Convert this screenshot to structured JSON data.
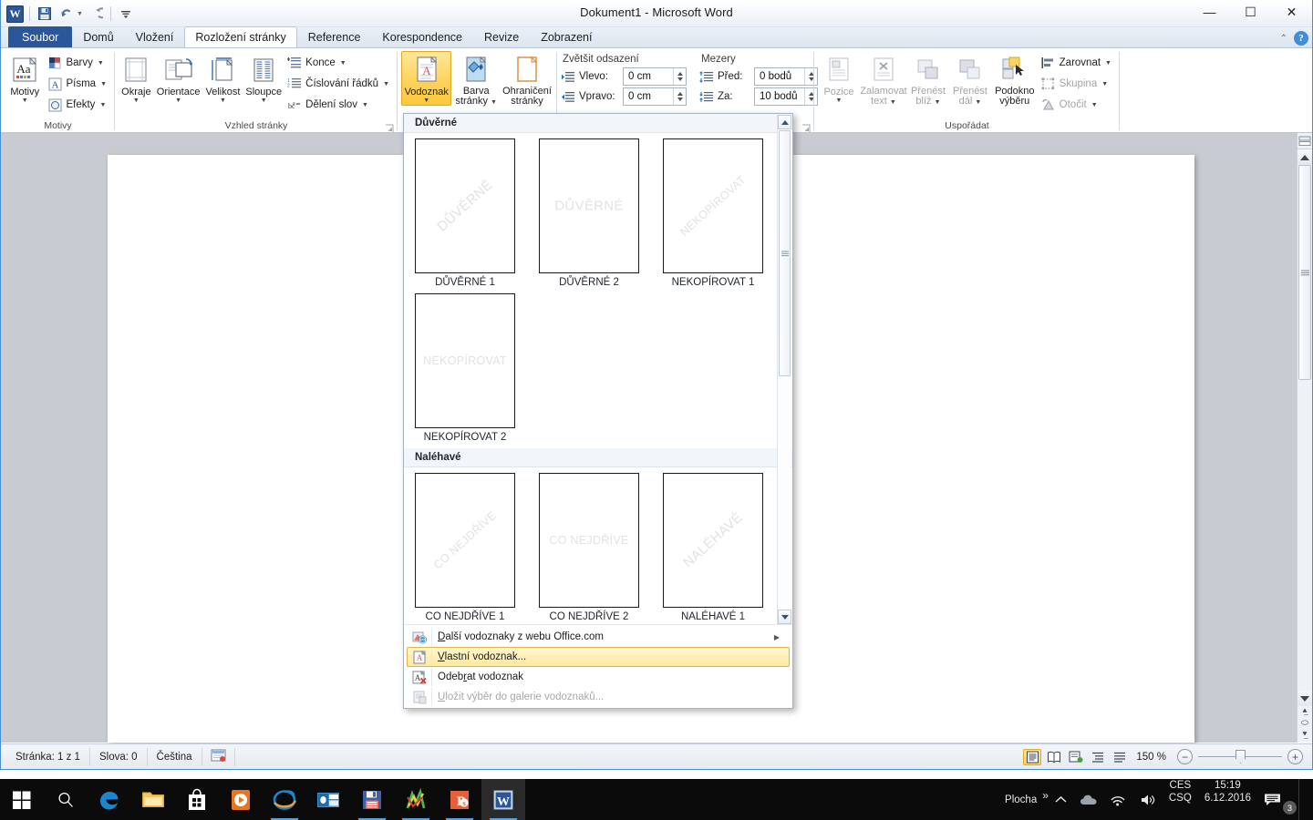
{
  "window": {
    "title": "Dokument1  -  Microsoft Word",
    "minimize_label": "—",
    "maximize_label": "☐",
    "close_label": "✕",
    "help_label": "?",
    "collapse_ribbon_label": "⌃"
  },
  "quick_access": {
    "app_logo": "W",
    "items": [
      {
        "name": "save-icon",
        "label": "Uložit"
      },
      {
        "name": "undo-icon",
        "label": "Zpět"
      },
      {
        "name": "redo-icon",
        "label": "Znovu"
      },
      {
        "name": "customize-qat-icon",
        "label": "Přizpůsobit panel nástrojů Rychlý přístup"
      }
    ]
  },
  "ribbon": {
    "tabs": [
      {
        "label": "Soubor",
        "kind": "file"
      },
      {
        "label": "Domů",
        "kind": "normal"
      },
      {
        "label": "Vložení",
        "kind": "normal"
      },
      {
        "label": "Rozložení stránky",
        "kind": "active"
      },
      {
        "label": "Reference",
        "kind": "normal"
      },
      {
        "label": "Korespondence",
        "kind": "normal"
      },
      {
        "label": "Revize",
        "kind": "normal"
      },
      {
        "label": "Zobrazení",
        "kind": "normal"
      }
    ],
    "groups": {
      "themes": {
        "label": "Motivy",
        "big_button": {
          "label": "Motivy",
          "icon": "themes-icon"
        },
        "small_buttons": [
          {
            "label": "Barvy",
            "icon": "theme-colors-icon",
            "has_dropdown": true
          },
          {
            "label": "Písma",
            "icon": "theme-fonts-icon",
            "has_dropdown": true
          },
          {
            "label": "Efekty",
            "icon": "theme-effects-icon",
            "has_dropdown": true
          }
        ]
      },
      "page_setup": {
        "label": "Vzhled stránky",
        "big_buttons": [
          {
            "label": "Okraje",
            "icon": "margins-icon"
          },
          {
            "label": "Orientace",
            "icon": "orientation-icon"
          },
          {
            "label": "Velikost",
            "icon": "size-icon"
          },
          {
            "label": "Sloupce",
            "icon": "columns-icon"
          }
        ],
        "small_buttons": [
          {
            "label": "Konce",
            "icon": "breaks-icon",
            "has_dropdown": true
          },
          {
            "label": "Číslování řádků",
            "icon": "line-numbers-icon",
            "has_dropdown": true
          },
          {
            "label": "Dělení slov",
            "icon": "hyphenation-icon",
            "has_dropdown": true
          }
        ]
      },
      "page_background": {
        "label": "",
        "big_buttons": [
          {
            "label": "Vodoznak",
            "icon": "watermark-icon",
            "selected": true,
            "has_dropdown": true
          },
          {
            "label": "Barva\nstránky",
            "icon": "page-color-icon",
            "has_dropdown": true
          },
          {
            "label": "Ohraničení\nstránky",
            "icon": "page-borders-icon"
          }
        ]
      },
      "paragraph": {
        "label": "",
        "indent_title": "Zvětšit odsazení",
        "spacing_title": "Mezery",
        "fields": [
          {
            "label": "Vlevo:",
            "value": "0 cm",
            "icon": "indent-left-icon"
          },
          {
            "label": "Vpravo:",
            "value": "0 cm",
            "icon": "indent-right-icon"
          },
          {
            "label": "Před:",
            "value": "0 bodů",
            "icon": "space-before-icon"
          },
          {
            "label": "Za:",
            "value": "10 bodů",
            "icon": "space-after-icon"
          }
        ]
      },
      "arrange": {
        "label": "Uspořádat",
        "big_buttons": [
          {
            "label": "Pozice",
            "icon": "position-icon",
            "disabled": true,
            "has_dropdown": true
          },
          {
            "label": "Zalamovat\ntext",
            "icon": "wrap-text-icon",
            "disabled": true,
            "has_dropdown": true
          },
          {
            "label": "Přenést\nblíž",
            "icon": "bring-forward-icon",
            "disabled": true,
            "has_dropdown": true
          },
          {
            "label": "Přenést\ndál",
            "icon": "send-backward-icon",
            "disabled": true,
            "has_dropdown": true
          },
          {
            "label": "Podokno\nvýběru",
            "icon": "selection-pane-icon"
          }
        ],
        "small_buttons": [
          {
            "label": "Zarovnat",
            "icon": "align-icon",
            "has_dropdown": true
          },
          {
            "label": "Skupina",
            "icon": "group-icon",
            "disabled": true,
            "has_dropdown": true
          },
          {
            "label": "Otočit",
            "icon": "rotate-icon",
            "disabled": true,
            "has_dropdown": true
          }
        ]
      }
    }
  },
  "watermark_menu": {
    "categories": [
      {
        "title": "Důvěrné",
        "items": [
          {
            "caption": "DŮVĚRNÉ 1",
            "text": "DŮVĚRNÉ",
            "orientation": "diagonal"
          },
          {
            "caption": "DŮVĚRNÉ 2",
            "text": "DŮVĚRNÉ",
            "orientation": "horizontal"
          },
          {
            "caption": "NEKOPÍROVAT 1",
            "text": "NEKOPÍROVAT",
            "orientation": "diagonal"
          },
          {
            "caption": "NEKOPÍROVAT 2",
            "text": "NEKOPÍROVAT",
            "orientation": "horizontal"
          }
        ]
      },
      {
        "title": "Naléhavé",
        "items": [
          {
            "caption": "CO NEJDŘÍVE 1",
            "text": "CO NEJDŘÍVE",
            "orientation": "diagonal"
          },
          {
            "caption": "CO NEJDŘÍVE 2",
            "text": "CO NEJDŘÍVE",
            "orientation": "horizontal"
          },
          {
            "caption": "NALÉHAVÉ 1",
            "text": "NALÉHAVÉ",
            "orientation": "diagonal"
          }
        ]
      }
    ],
    "commands": [
      {
        "label": "Další vodoznaky z webu Office.com",
        "icon": "office-online-icon",
        "state": "normal",
        "submenu": true
      },
      {
        "label": "Vlastní vodoznak...",
        "icon": "custom-watermark-icon",
        "state": "highlighted",
        "submenu": false
      },
      {
        "label": "Odebrat vodoznak",
        "icon": "remove-watermark-icon",
        "state": "normal",
        "submenu": false
      },
      {
        "label": "Uložit výběr do galerie vodoznaků...",
        "icon": "save-to-gallery-icon",
        "state": "disabled",
        "submenu": false
      }
    ]
  },
  "status_bar": {
    "page": "Stránka: 1 z 1",
    "words": "Slova: 0",
    "language": "Čeština",
    "proofing_icon": "proofing-errors-icon",
    "views": [
      {
        "name": "print-layout-view",
        "active": true
      },
      {
        "name": "full-screen-reading-view",
        "active": false
      },
      {
        "name": "web-layout-view",
        "active": false
      },
      {
        "name": "outline-view",
        "active": false
      },
      {
        "name": "draft-view",
        "active": false
      }
    ],
    "zoom": "150 %",
    "zoom_out_label": "−",
    "zoom_in_label": "+"
  },
  "taskbar": {
    "start_label": "Start",
    "search_label": "Hledat",
    "apps": [
      {
        "name": "taskbar-edge",
        "running": false
      },
      {
        "name": "taskbar-file-explorer",
        "running": false
      },
      {
        "name": "taskbar-store",
        "running": false
      },
      {
        "name": "taskbar-media-player",
        "running": false
      },
      {
        "name": "taskbar-internet-explorer",
        "running": true
      },
      {
        "name": "taskbar-outlook",
        "running": false
      },
      {
        "name": "taskbar-save-app",
        "running": true
      },
      {
        "name": "taskbar-graph-app",
        "running": true
      },
      {
        "name": "taskbar-powerpoint",
        "running": true
      },
      {
        "name": "taskbar-word",
        "running": true,
        "active": true
      }
    ],
    "show_desktop_label": "Plocha",
    "overflow_label": "»",
    "keyboard_line1": "CES",
    "keyboard_line2": "CSQ",
    "time": "15:19",
    "date": "6.12.2016",
    "notification_count": "3"
  },
  "colors": {
    "accent": "#2b579a",
    "selected_gold": "#fdd35c",
    "highlight_yellow": "#ffe9a0",
    "window_border": "#4a8fd0",
    "canvas_gray": "#c8ccd2"
  }
}
